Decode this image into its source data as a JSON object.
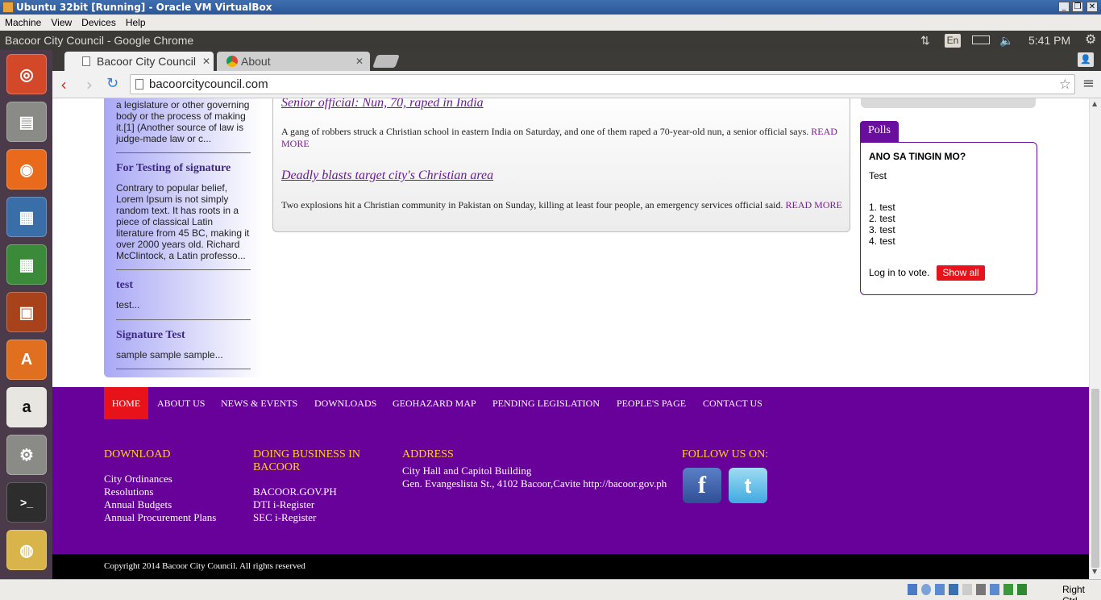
{
  "vbox": {
    "title": "Ubuntu 32bit [Running] - Oracle VM VirtualBox",
    "menu": [
      "Machine",
      "View",
      "Devices",
      "Help"
    ],
    "host_key": "Right Ctrl"
  },
  "ubuntu_panel": {
    "window_title": "Bacoor City Council - Google Chrome",
    "keyboard": "En",
    "clock": "5:41 PM"
  },
  "launcher": {
    "apps": [
      "ubuntu-dash",
      "files",
      "firefox",
      "libreoffice-writer",
      "libreoffice-calc",
      "libreoffice-impress",
      "ubuntu-software-center",
      "amazon",
      "system-settings",
      "terminal",
      "chrome"
    ]
  },
  "browser": {
    "tabs": [
      {
        "label": "Bacoor City Council",
        "active": true
      },
      {
        "label": "About",
        "active": false
      }
    ],
    "url": "bacoorcitycouncil.com"
  },
  "sidebar": {
    "intro_text": "a legislature or other governing body or the process of making it.[1] (Another source of law is judge-made law or c...",
    "articles": [
      {
        "title": "For Testing of signature",
        "excerpt": "Contrary to popular belief, Lorem Ipsum is not simply random text. It has roots in a piece of classical Latin literature from 45 BC, making it over 2000 years old. Richard McClintock, a Latin professo..."
      },
      {
        "title": "test",
        "excerpt": "test..."
      },
      {
        "title": "Signature Test",
        "excerpt": "sample sample sample..."
      }
    ]
  },
  "news": {
    "items": [
      {
        "title": "Senior official: Nun, 70, raped in India",
        "body": "A gang of robbers struck a Christian school in eastern India on Saturday, and one of them raped a 70-year-old nun, a senior official says.",
        "more": "READ MORE"
      },
      {
        "title": "Deadly blasts target city's Christian area",
        "body": "Two explosions hit a Christian community in Pakistan on Sunday, killing at least four people, an emergency services official said.",
        "more": "READ MORE"
      }
    ]
  },
  "poll": {
    "tab_label": "Polls",
    "question": "ANO SA TINGIN MO?",
    "subtitle": "Test",
    "options": [
      "1. test",
      "2. test",
      "3. test",
      "4. test"
    ],
    "login_text": "Log in to vote.",
    "show_all": "Show all"
  },
  "footer": {
    "nav": [
      "HOME",
      "ABOUT US",
      "NEWS & EVENTS",
      "DOWNLOADS",
      "GEOHAZARD MAP",
      "PENDING LEGISLATION",
      "PEOPLE'S PAGE",
      "CONTACT US"
    ],
    "download": {
      "heading": "DOWNLOAD",
      "links": [
        "City Ordinances",
        "Resolutions",
        "Annual Budgets",
        "Annual Procurement Plans"
      ]
    },
    "business": {
      "heading": "DOING BUSINESS IN BACOOR",
      "links": [
        "BACOOR.GOV.PH",
        "DTI i-Register",
        "SEC i-Register"
      ]
    },
    "address": {
      "heading": "ADDRESS",
      "line1": "City Hall and Capitol Building",
      "line2": "Gen. Evangeslista St., 4102 Bacoor,Cavite http://bacoor.gov.ph"
    },
    "follow": {
      "heading": "FOLLOW US ON:"
    },
    "copyright": "Copyright 2014 Bacoor City Council. All rights reserved"
  },
  "colors": {
    "footer_purple": "#68009a",
    "accent_red": "#e8131a",
    "heading_yellow": "#ffd21e"
  }
}
